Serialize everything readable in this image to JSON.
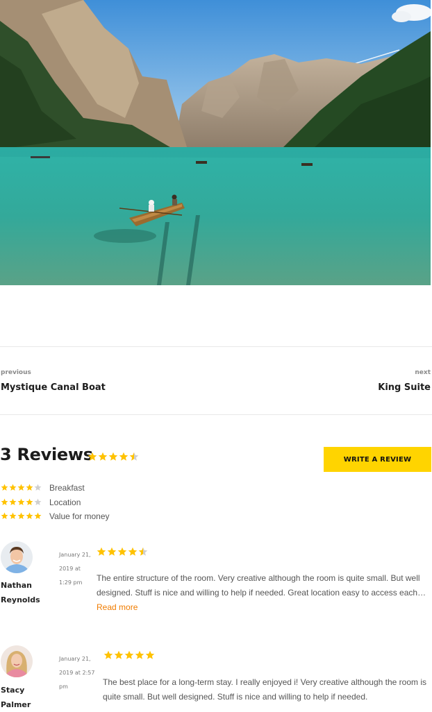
{
  "hero": {
    "alt_icon": "lake-landscape-photo"
  },
  "post_nav": {
    "previous": {
      "tag": "previous",
      "title": "Mystique Canal Boat"
    },
    "next": {
      "tag": "next",
      "title": "King Suite"
    }
  },
  "reviews": {
    "heading": "3 Reviews",
    "overall_rating": 4.5,
    "write_review_label": "WRITE A REVIEW",
    "categories": [
      {
        "label": "Breakfast",
        "rating": 4
      },
      {
        "label": "Location",
        "rating": 4
      },
      {
        "label": "Value for money",
        "rating": 5
      }
    ],
    "items": [
      {
        "name": "Nathan Reynolds",
        "date": "January 21, 2019 at 1:29 pm",
        "rating": 4.5,
        "text": "The entire structure of the room. Very creative although the room is quite small. But well designed. Stuff is nice and willing to help if needed. Great location easy to access each…",
        "read_more": "Read more"
      },
      {
        "name": "Stacy Palmer",
        "date": "January 21, 2019 at 2:57 pm",
        "rating": 5,
        "text": "The best place for a long-term stay. I really enjoyed i! Very creative although the room is quite small. But well designed. Stuff is nice and willing to help if needed.",
        "read_more": ""
      }
    ]
  },
  "colors": {
    "accent": "#ffd400",
    "star": "#ffc200",
    "star_empty": "#cfcfcf",
    "link": "#f07c00"
  }
}
